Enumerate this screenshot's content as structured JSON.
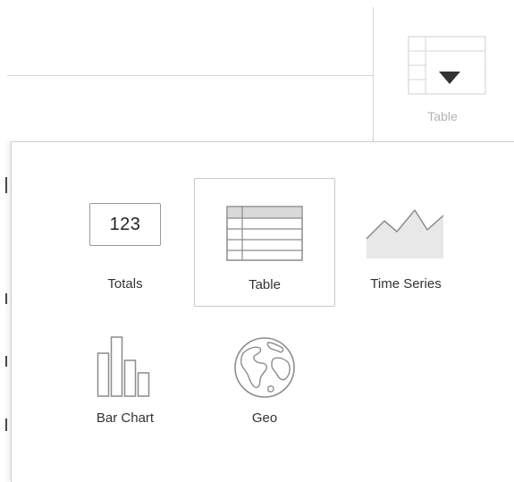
{
  "header": {
    "viz_toggle_label": "Table"
  },
  "picker": {
    "options": [
      {
        "label": "Totals",
        "icon": "totals-icon",
        "icon_text": "123"
      },
      {
        "label": "Table",
        "icon": "table-icon",
        "selected": true
      },
      {
        "label": "Time Series",
        "icon": "area-chart-icon"
      },
      {
        "label": "Bar Chart",
        "icon": "bar-chart-icon"
      },
      {
        "label": "Geo",
        "icon": "globe-icon"
      }
    ]
  },
  "colors": {
    "icon_stroke": "#8c8c8c",
    "table_header_fill": "#d9d9d9",
    "selected_border": "#c8c8c8",
    "muted_label": "#b3b3b3"
  }
}
